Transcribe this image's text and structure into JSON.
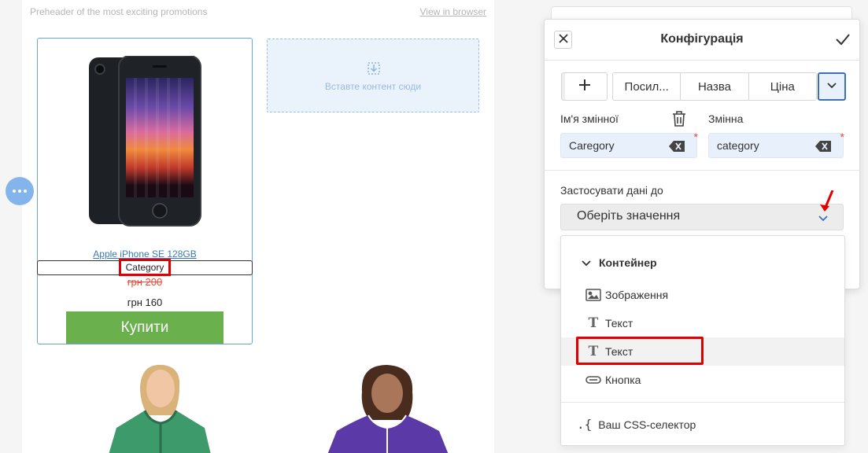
{
  "email": {
    "preheader": "Preheader of the most exciting promotions",
    "view_in_browser": "View in browser",
    "product": {
      "name": "Apple iPhone SE 128GB",
      "category": "Category",
      "old_price": "грн 200",
      "new_price": "грн 160",
      "buy_label": "Купити"
    },
    "dropzone_text": "Вставте контент сюди"
  },
  "panel": {
    "title": "Конфігурація",
    "tabs": [
      "Посил...",
      "Назва",
      "Ціна"
    ],
    "var_name_label": "Ім'я змінної",
    "var_label": "Змінна",
    "var_name_value": "Caregory",
    "var_value": "category",
    "apply_label": "Застосувати дані до",
    "select_placeholder": "Оберіть значення"
  },
  "dropdown": {
    "group_label": "Контейнер",
    "items": [
      {
        "label": "Зображення",
        "icon": "image-icon"
      },
      {
        "label": "Текст",
        "icon": "text-icon"
      },
      {
        "label": "Текст",
        "icon": "text-icon"
      },
      {
        "label": "Кнопка",
        "icon": "button-icon"
      }
    ],
    "css_selector_label": "Ваш CSS-селектор"
  },
  "colors": {
    "accent_blue": "#3b6fb6",
    "buy_green": "#6ab04c",
    "highlight_red": "#e00000",
    "link_blue": "#3a7ab5"
  }
}
